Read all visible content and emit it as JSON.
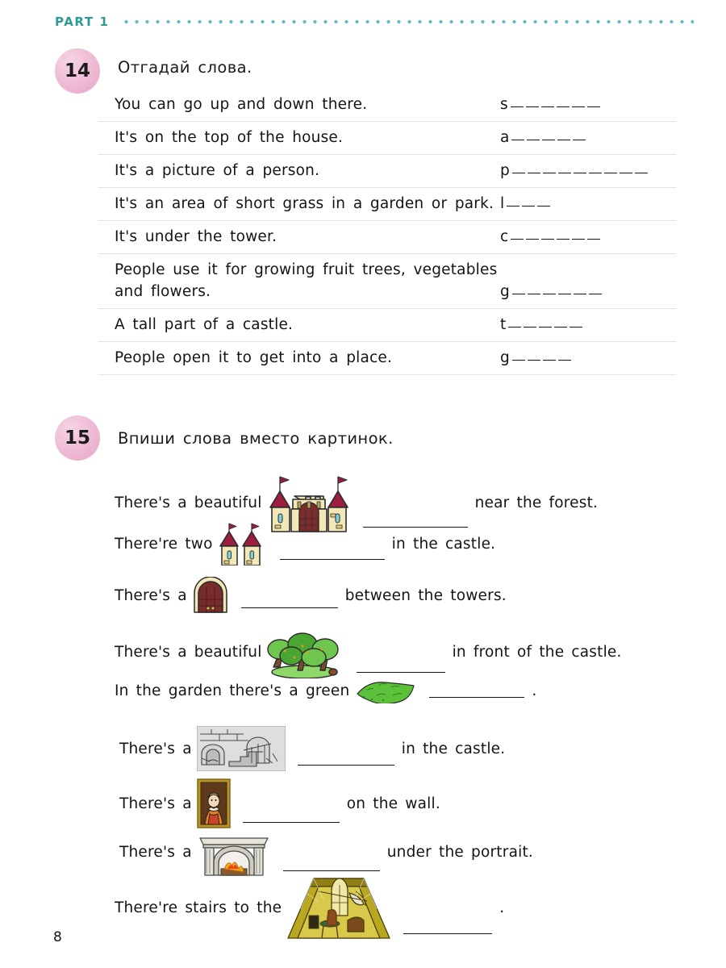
{
  "header": {
    "part_label": "PART 1"
  },
  "page_number": "8",
  "exercise14": {
    "number": "14",
    "title": "Отгадай слова.",
    "rows": [
      {
        "text": "You can go up and down there.",
        "letter": "s",
        "blanks": 6
      },
      {
        "text": "It's on the top of the house.",
        "letter": "a",
        "blanks": 5
      },
      {
        "text": "It's a picture of a person.",
        "letter": "p",
        "blanks": 9
      },
      {
        "text": "It's an area of short grass in a garden or park.",
        "letter": "l",
        "blanks": 3
      },
      {
        "text": "It's under the tower.",
        "letter": "c",
        "blanks": 6
      },
      {
        "text": "People use it for growing fruit trees, vegetables and flowers.",
        "letter": "g",
        "blanks": 6
      },
      {
        "text": "A tall part of a castle.",
        "letter": "t",
        "blanks": 5
      },
      {
        "text": "People open it to get into a place.",
        "letter": "g",
        "blanks": 4
      }
    ]
  },
  "exercise15": {
    "number": "15",
    "title": "Впиши слова вместо картинок.",
    "sentences": [
      {
        "before": "There's a beautiful",
        "picture": "castle-picture",
        "after": "near the forest."
      },
      {
        "before": "There're two",
        "picture": "towers-picture",
        "after": "in the castle."
      },
      {
        "before": "There's a",
        "picture": "gate-picture",
        "after": "between the towers."
      },
      {
        "before": "There's a beautiful",
        "picture": "garden-picture",
        "after": "in front of the castle."
      },
      {
        "before": "In the garden there's a green",
        "picture": "lawn-picture",
        "after": "."
      },
      {
        "before": "There's a",
        "picture": "cellar-picture",
        "after": "in the castle."
      },
      {
        "before": "There's a",
        "picture": "portrait-picture",
        "after": "on the wall."
      },
      {
        "before": "There's a",
        "picture": "fireplace-picture",
        "after": "under the portrait."
      },
      {
        "before": "There're stairs to the",
        "picture": "attic-picture",
        "after": "."
      }
    ]
  },
  "colors": {
    "part_accent": "#2e9a97",
    "dots": "#5fb8c4",
    "bubble_pink": "#eeb9d4",
    "castle_wall": "#f2e7b6",
    "castle_roof": "#9c1f40",
    "door_red": "#7a2b2b",
    "tree_green": "#56b445",
    "lawn_green": "#5cc13a",
    "stone_grey": "#c9c9c9",
    "frame_gold": "#b99327",
    "attic_olive": "#9c8a1e",
    "text": "#141414"
  }
}
